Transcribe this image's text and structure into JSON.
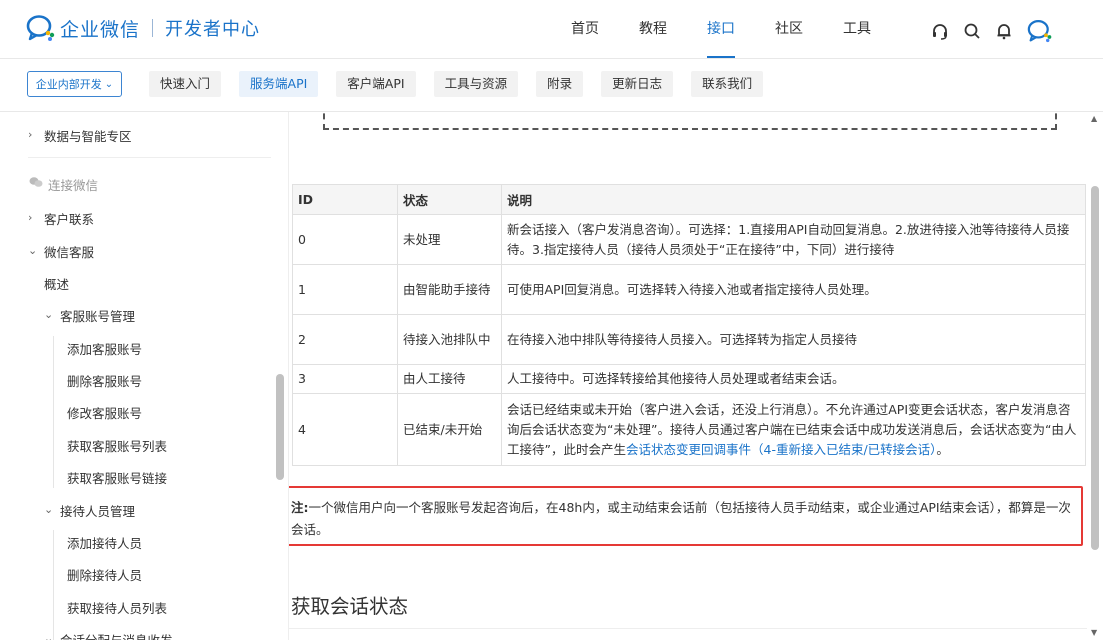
{
  "header": {
    "brand": "企业微信",
    "subtitle": "开发者中心",
    "nav": [
      "首页",
      "教程",
      "接口",
      "社区",
      "工具"
    ],
    "active_nav_index": 2,
    "icons": [
      "headset-icon",
      "search-icon",
      "bell-icon",
      "wecom-logo-icon"
    ]
  },
  "subnav": {
    "dropdown_label": "企业内部开发",
    "tabs": [
      "快速入门",
      "服务端API",
      "客户端API",
      "工具与资源",
      "附录",
      "更新日志",
      "联系我们"
    ],
    "active_tab_index": 1
  },
  "sidebar": {
    "items": [
      {
        "label": "数据与智能专区",
        "arrow": "›"
      },
      {
        "label": "连接微信",
        "muted": true
      },
      {
        "label": "客户联系",
        "arrow": "›"
      },
      {
        "label": "微信客服",
        "arrow": "⌄"
      },
      {
        "label": "概述"
      },
      {
        "label": "客服账号管理",
        "arrow": "⌄"
      },
      {
        "label": "添加客服账号"
      },
      {
        "label": "删除客服账号"
      },
      {
        "label": "修改客服账号"
      },
      {
        "label": "获取客服账号列表"
      },
      {
        "label": "获取客服账号链接"
      },
      {
        "label": "接待人员管理",
        "arrow": "⌄"
      },
      {
        "label": "添加接待人员"
      },
      {
        "label": "删除接待人员"
      },
      {
        "label": "获取接待人员列表"
      },
      {
        "label": "会话分配与消息收发",
        "arrow": "⌄"
      }
    ]
  },
  "table": {
    "headers": [
      "ID",
      "状态",
      "说明"
    ],
    "rows": [
      {
        "id": "0",
        "status": "未处理",
        "desc": "新会话接入（客户发消息咨询）。可选择：1.直接用API自动回复消息。2.放进待接入池等待接待人员接待。3.指定接待人员（接待人员须处于“正在接待”中，下同）进行接待"
      },
      {
        "id": "1",
        "status": "由智能助手接待",
        "desc": "可使用API回复消息。可选择转入待接入池或者指定接待人员处理。"
      },
      {
        "id": "2",
        "status": "待接入池排队中",
        "desc": "在待接入池中排队等待接待人员接入。可选择转为指定人员接待"
      },
      {
        "id": "3",
        "status": "由人工接待",
        "desc": "人工接待中。可选择转接给其他接待人员处理或者结束会话。"
      },
      {
        "id": "4",
        "status": "已结束/未开始",
        "desc": "会话已经结束或未开始（客户进入会话，还没上行消息）。不允许通过API变更会话状态，客户发消息咨询后会话状态变为“未处理”。接待人员通过客户端在已结束会话中成功发送消息后，会话状态变为“由人工接待”，此时会产生",
        "link": "会话状态变更回调事件（4-重新接入已结束/已转接会话）",
        "tail": "。"
      }
    ]
  },
  "note": {
    "label": "注:",
    "text": "一个微信用户向一个客服账号发起咨询后，在48h内，或主动结束会话前（包括接待人员手动结束，或企业通过API结束会话），都算是一次会话。"
  },
  "section_title": "获取会话状态",
  "colors": {
    "accent": "#1a73c9",
    "highlight": "#e53935"
  }
}
